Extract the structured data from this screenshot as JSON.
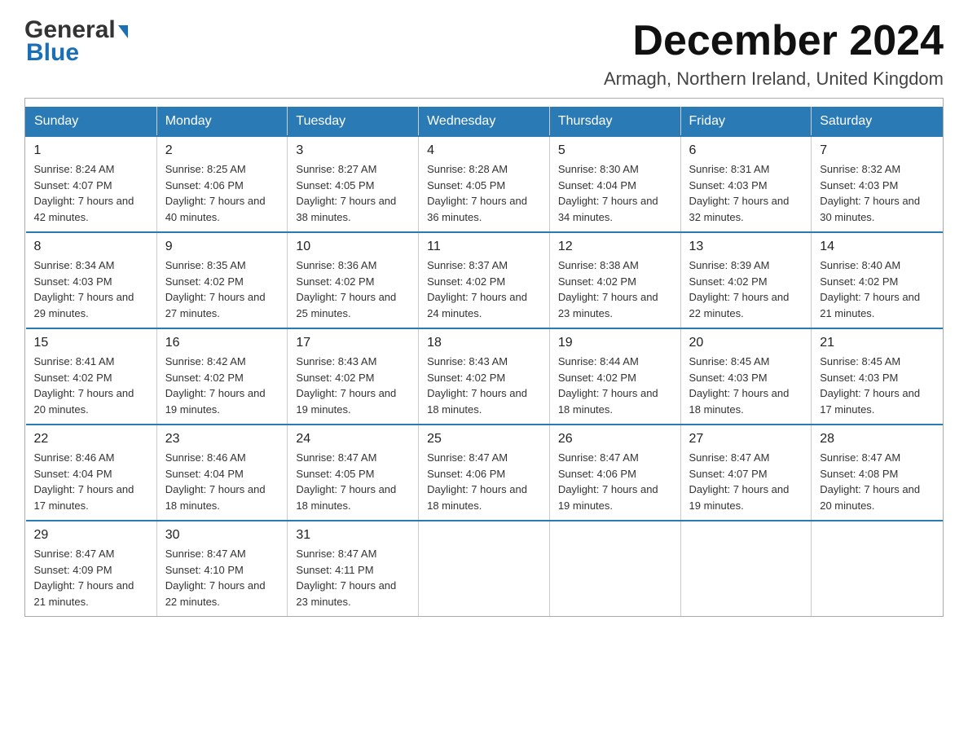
{
  "header": {
    "logo": {
      "general": "General",
      "blue": "Blue",
      "arrow": "▶"
    },
    "title": "December 2024",
    "location": "Armagh, Northern Ireland, United Kingdom"
  },
  "calendar": {
    "days": [
      "Sunday",
      "Monday",
      "Tuesday",
      "Wednesday",
      "Thursday",
      "Friday",
      "Saturday"
    ],
    "weeks": [
      [
        {
          "day": "1",
          "sunrise": "Sunrise: 8:24 AM",
          "sunset": "Sunset: 4:07 PM",
          "daylight": "Daylight: 7 hours and 42 minutes."
        },
        {
          "day": "2",
          "sunrise": "Sunrise: 8:25 AM",
          "sunset": "Sunset: 4:06 PM",
          "daylight": "Daylight: 7 hours and 40 minutes."
        },
        {
          "day": "3",
          "sunrise": "Sunrise: 8:27 AM",
          "sunset": "Sunset: 4:05 PM",
          "daylight": "Daylight: 7 hours and 38 minutes."
        },
        {
          "day": "4",
          "sunrise": "Sunrise: 8:28 AM",
          "sunset": "Sunset: 4:05 PM",
          "daylight": "Daylight: 7 hours and 36 minutes."
        },
        {
          "day": "5",
          "sunrise": "Sunrise: 8:30 AM",
          "sunset": "Sunset: 4:04 PM",
          "daylight": "Daylight: 7 hours and 34 minutes."
        },
        {
          "day": "6",
          "sunrise": "Sunrise: 8:31 AM",
          "sunset": "Sunset: 4:03 PM",
          "daylight": "Daylight: 7 hours and 32 minutes."
        },
        {
          "day": "7",
          "sunrise": "Sunrise: 8:32 AM",
          "sunset": "Sunset: 4:03 PM",
          "daylight": "Daylight: 7 hours and 30 minutes."
        }
      ],
      [
        {
          "day": "8",
          "sunrise": "Sunrise: 8:34 AM",
          "sunset": "Sunset: 4:03 PM",
          "daylight": "Daylight: 7 hours and 29 minutes."
        },
        {
          "day": "9",
          "sunrise": "Sunrise: 8:35 AM",
          "sunset": "Sunset: 4:02 PM",
          "daylight": "Daylight: 7 hours and 27 minutes."
        },
        {
          "day": "10",
          "sunrise": "Sunrise: 8:36 AM",
          "sunset": "Sunset: 4:02 PM",
          "daylight": "Daylight: 7 hours and 25 minutes."
        },
        {
          "day": "11",
          "sunrise": "Sunrise: 8:37 AM",
          "sunset": "Sunset: 4:02 PM",
          "daylight": "Daylight: 7 hours and 24 minutes."
        },
        {
          "day": "12",
          "sunrise": "Sunrise: 8:38 AM",
          "sunset": "Sunset: 4:02 PM",
          "daylight": "Daylight: 7 hours and 23 minutes."
        },
        {
          "day": "13",
          "sunrise": "Sunrise: 8:39 AM",
          "sunset": "Sunset: 4:02 PM",
          "daylight": "Daylight: 7 hours and 22 minutes."
        },
        {
          "day": "14",
          "sunrise": "Sunrise: 8:40 AM",
          "sunset": "Sunset: 4:02 PM",
          "daylight": "Daylight: 7 hours and 21 minutes."
        }
      ],
      [
        {
          "day": "15",
          "sunrise": "Sunrise: 8:41 AM",
          "sunset": "Sunset: 4:02 PM",
          "daylight": "Daylight: 7 hours and 20 minutes."
        },
        {
          "day": "16",
          "sunrise": "Sunrise: 8:42 AM",
          "sunset": "Sunset: 4:02 PM",
          "daylight": "Daylight: 7 hours and 19 minutes."
        },
        {
          "day": "17",
          "sunrise": "Sunrise: 8:43 AM",
          "sunset": "Sunset: 4:02 PM",
          "daylight": "Daylight: 7 hours and 19 minutes."
        },
        {
          "day": "18",
          "sunrise": "Sunrise: 8:43 AM",
          "sunset": "Sunset: 4:02 PM",
          "daylight": "Daylight: 7 hours and 18 minutes."
        },
        {
          "day": "19",
          "sunrise": "Sunrise: 8:44 AM",
          "sunset": "Sunset: 4:02 PM",
          "daylight": "Daylight: 7 hours and 18 minutes."
        },
        {
          "day": "20",
          "sunrise": "Sunrise: 8:45 AM",
          "sunset": "Sunset: 4:03 PM",
          "daylight": "Daylight: 7 hours and 18 minutes."
        },
        {
          "day": "21",
          "sunrise": "Sunrise: 8:45 AM",
          "sunset": "Sunset: 4:03 PM",
          "daylight": "Daylight: 7 hours and 17 minutes."
        }
      ],
      [
        {
          "day": "22",
          "sunrise": "Sunrise: 8:46 AM",
          "sunset": "Sunset: 4:04 PM",
          "daylight": "Daylight: 7 hours and 17 minutes."
        },
        {
          "day": "23",
          "sunrise": "Sunrise: 8:46 AM",
          "sunset": "Sunset: 4:04 PM",
          "daylight": "Daylight: 7 hours and 18 minutes."
        },
        {
          "day": "24",
          "sunrise": "Sunrise: 8:47 AM",
          "sunset": "Sunset: 4:05 PM",
          "daylight": "Daylight: 7 hours and 18 minutes."
        },
        {
          "day": "25",
          "sunrise": "Sunrise: 8:47 AM",
          "sunset": "Sunset: 4:06 PM",
          "daylight": "Daylight: 7 hours and 18 minutes."
        },
        {
          "day": "26",
          "sunrise": "Sunrise: 8:47 AM",
          "sunset": "Sunset: 4:06 PM",
          "daylight": "Daylight: 7 hours and 19 minutes."
        },
        {
          "day": "27",
          "sunrise": "Sunrise: 8:47 AM",
          "sunset": "Sunset: 4:07 PM",
          "daylight": "Daylight: 7 hours and 19 minutes."
        },
        {
          "day": "28",
          "sunrise": "Sunrise: 8:47 AM",
          "sunset": "Sunset: 4:08 PM",
          "daylight": "Daylight: 7 hours and 20 minutes."
        }
      ],
      [
        {
          "day": "29",
          "sunrise": "Sunrise: 8:47 AM",
          "sunset": "Sunset: 4:09 PM",
          "daylight": "Daylight: 7 hours and 21 minutes."
        },
        {
          "day": "30",
          "sunrise": "Sunrise: 8:47 AM",
          "sunset": "Sunset: 4:10 PM",
          "daylight": "Daylight: 7 hours and 22 minutes."
        },
        {
          "day": "31",
          "sunrise": "Sunrise: 8:47 AM",
          "sunset": "Sunset: 4:11 PM",
          "daylight": "Daylight: 7 hours and 23 minutes."
        },
        null,
        null,
        null,
        null
      ]
    ]
  }
}
